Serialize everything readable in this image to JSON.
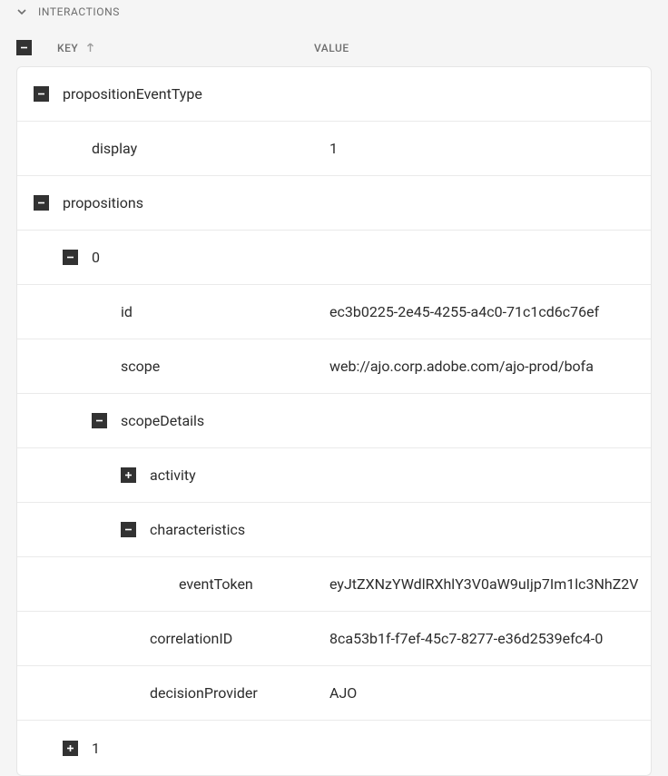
{
  "section": {
    "title": "INTERACTIONS"
  },
  "columns": {
    "key": "KEY",
    "value": "VALUE"
  },
  "rows": [
    {
      "indent": 0,
      "toggle": "minus",
      "key": "propositionEventType",
      "value": ""
    },
    {
      "indent": 1,
      "toggle": "none",
      "key": "display",
      "value": "1"
    },
    {
      "indent": 0,
      "toggle": "minus",
      "key": "propositions",
      "value": ""
    },
    {
      "indent": 1,
      "toggle": "minus",
      "key": "0",
      "value": ""
    },
    {
      "indent": 2,
      "toggle": "none",
      "key": "id",
      "value": "ec3b0225-2e45-4255-a4c0-71c1cd6c76ef"
    },
    {
      "indent": 2,
      "toggle": "none",
      "key": "scope",
      "value": "web://ajo.corp.adobe.com/ajo-prod/bofa"
    },
    {
      "indent": 2,
      "toggle": "minus",
      "key": "scopeDetails",
      "value": ""
    },
    {
      "indent": 3,
      "toggle": "plus",
      "key": "activity",
      "value": ""
    },
    {
      "indent": 3,
      "toggle": "minus",
      "key": "characteristics",
      "value": ""
    },
    {
      "indent": 4,
      "toggle": "none",
      "key": "eventToken",
      "value": "eyJtZXNzYWdlRXhlY3V0aW9uIjp7Im1lc3NhZ2V"
    },
    {
      "indent": 3,
      "toggle": "none",
      "key": "correlationID",
      "value": "8ca53b1f-f7ef-45c7-8277-e36d2539efc4-0"
    },
    {
      "indent": 3,
      "toggle": "none",
      "key": "decisionProvider",
      "value": "AJO"
    },
    {
      "indent": 1,
      "toggle": "plus",
      "key": "1",
      "value": ""
    }
  ]
}
